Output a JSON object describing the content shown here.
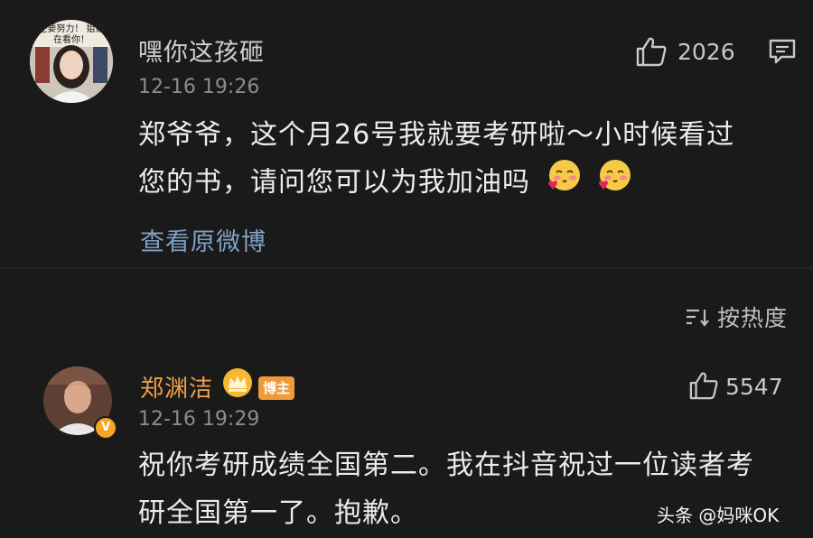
{
  "comment1": {
    "username": "嘿你这孩砸",
    "avatar_text": "还要努力！ 姐姐在看你！",
    "timestamp": "12-16 19:26",
    "like_count": "2026",
    "body_line1": "郑爷爷，这个月26号我就要考研啦～小时候看过",
    "body_line2": "您的书，请问您可以为我加油吗",
    "view_original": "查看原微博"
  },
  "sort": {
    "label": "按热度"
  },
  "comment2": {
    "username": "郑渊洁",
    "badge": "博主",
    "timestamp": "12-16 19:29",
    "like_count": "5547",
    "body_line1": "祝你考研成绩全国第二。我在抖音祝过一位读者考",
    "body_line2": "研全国第一了。抱歉。"
  },
  "watermark": "头条 @妈咪OK",
  "colors": {
    "background": "#1a1a1a",
    "link": "#7fa1c4",
    "author_name": "#f0a04b",
    "badge": "#f09a3a"
  }
}
